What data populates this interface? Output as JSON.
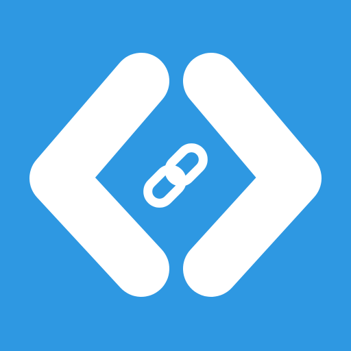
{
  "app_icon": {
    "icon_name": "code-link-icon",
    "elements": [
      "left-angle-bracket-icon",
      "right-angle-bracket-icon",
      "chain-link-icon"
    ],
    "colors": {
      "background": "#2E98E2",
      "glyph": "#FFFFFF"
    }
  }
}
